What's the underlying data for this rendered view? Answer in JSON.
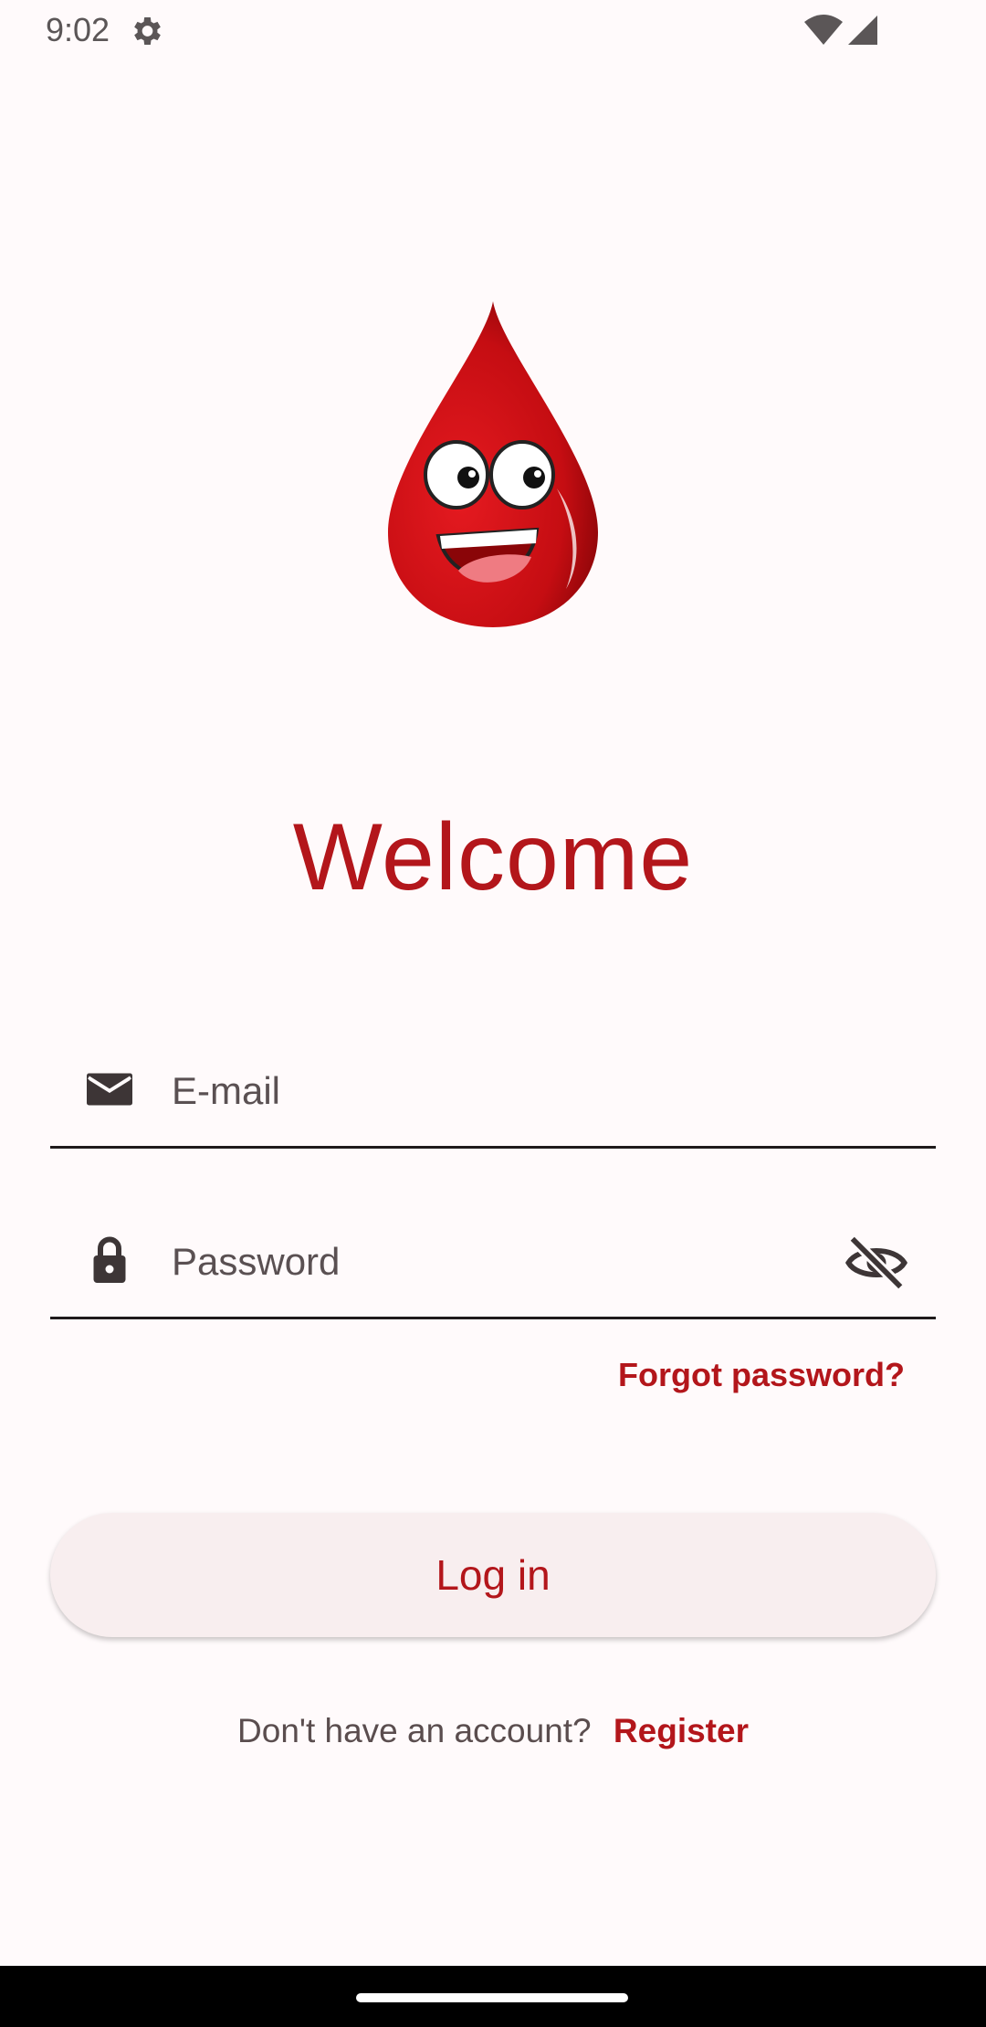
{
  "status_bar": {
    "time": "9:02",
    "icons": [
      "gear-icon",
      "wifi-icon",
      "signal-icon"
    ]
  },
  "logo": {
    "icon": "blood-drop-mascot-icon",
    "colors": {
      "drop": "#d10f14",
      "drop_dark": "#8a0508"
    }
  },
  "welcome": {
    "title": "Welcome"
  },
  "form": {
    "email": {
      "placeholder": "E-mail",
      "value": "",
      "icon": "mail-icon"
    },
    "password": {
      "placeholder": "Password",
      "value": "",
      "icon": "lock-icon",
      "toggle_icon": "visibility-off-icon"
    },
    "forgot_label": "Forgot password?",
    "login_label": "Log in"
  },
  "register": {
    "prompt": "Don't have an account?",
    "link": "Register"
  },
  "theme": {
    "accent": "#b3161b",
    "background": "#fffafb",
    "button_bg": "#f8eeef"
  }
}
